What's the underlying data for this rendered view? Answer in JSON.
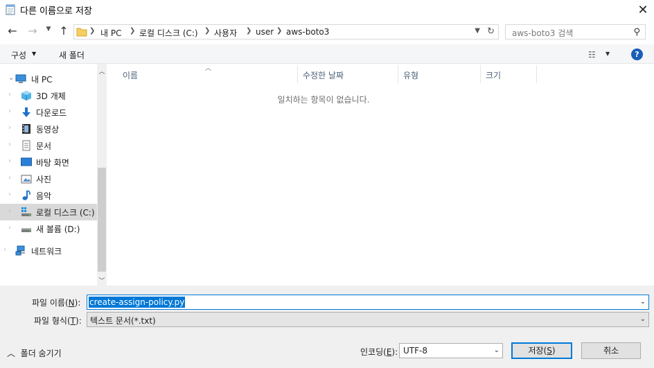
{
  "window": {
    "title": "다른 이름으로 저장",
    "close_glyph": "✕"
  },
  "address": {
    "crumbs": [
      "내 PC",
      "로컬 디스크 (C:)",
      "사용자",
      "user",
      "aws-boto3"
    ],
    "search_placeholder": "aws-boto3 검색"
  },
  "toolbar": {
    "organize": "구성",
    "new_folder": "새 폴더"
  },
  "nav": {
    "items": [
      {
        "label": "내 PC",
        "icon": "computer-icon"
      },
      {
        "label": "3D 개체",
        "icon": "cube-3d-icon"
      },
      {
        "label": "다운로드",
        "icon": "download-icon"
      },
      {
        "label": "동영상",
        "icon": "video-icon"
      },
      {
        "label": "문서",
        "icon": "document-icon"
      },
      {
        "label": "바탕 화면",
        "icon": "desktop-icon"
      },
      {
        "label": "사진",
        "icon": "pictures-icon"
      },
      {
        "label": "음악",
        "icon": "music-icon"
      },
      {
        "label": "로컬 디스크 (C:)",
        "icon": "local-disk-icon"
      },
      {
        "label": "새 볼륨 (D:)",
        "icon": "drive-icon"
      },
      {
        "label": "네트워크",
        "icon": "network-icon"
      }
    ],
    "selected": "로컬 디스크 (C:)"
  },
  "filelist": {
    "columns": [
      "이름",
      "수정한 날짜",
      "유형",
      "크기"
    ],
    "empty_message": "일치하는 항목이 없습니다."
  },
  "form": {
    "filename_label": "파일 이름",
    "filename_hotkey": "N",
    "filename_value": "create-assign-policy.py",
    "filetype_label": "파일 형식",
    "filetype_hotkey": "T",
    "filetype_value": "텍스트 문서(*.txt)",
    "encoding_label": "인코딩",
    "encoding_hotkey": "E",
    "encoding_value": "UTF-8",
    "hide_folders": "폴더 숨기기",
    "save": "저장",
    "save_hotkey": "S",
    "cancel": "취소"
  },
  "colors": {
    "accent": "#0078d7",
    "help": "#1a5eb8",
    "selection": "#d9d9d9"
  }
}
